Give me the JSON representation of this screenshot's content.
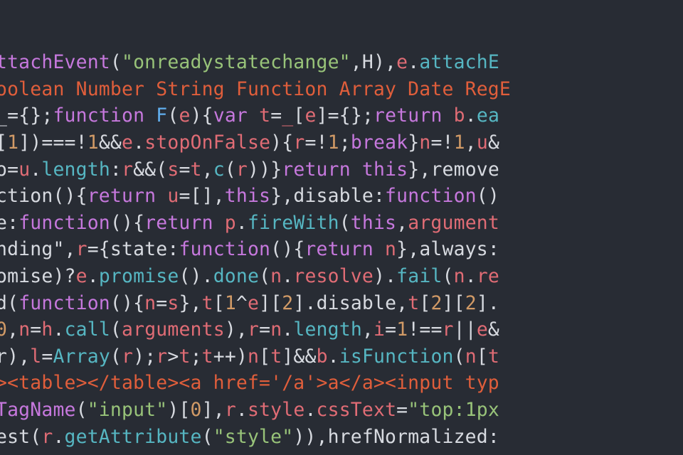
{
  "colors": {
    "background": "#282c34",
    "default": "#d7dae0",
    "keyword": "#c678dd",
    "identifier": "#e06c75",
    "call": "#56b6c2",
    "string": "#98c379",
    "number": "#d19a66",
    "type": "#e05e3b",
    "fn": "#61afef"
  },
  "lines": [
    [
      {
        "c": "c-kw",
        "t": "ttachEvent"
      },
      {
        "c": "c-def",
        "t": "("
      },
      {
        "c": "c-str",
        "t": "\"onreadystatechange\""
      },
      {
        "c": "c-def",
        "t": ",H),"
      },
      {
        "c": "c-red",
        "t": "e"
      },
      {
        "c": "c-def",
        "t": "."
      },
      {
        "c": "c-cyan",
        "t": "attachE"
      }
    ],
    [
      {
        "c": "c-dora",
        "t": "oolean Number String Function Array Date RegE"
      }
    ],
    [
      {
        "c": "c-def",
        "t": "_="
      },
      {
        "c": "c-def",
        "t": "{}"
      },
      {
        "c": "c-def",
        "t": ";"
      },
      {
        "c": "c-kw",
        "t": "function"
      },
      {
        "c": "c-def",
        "t": " "
      },
      {
        "c": "c-fn",
        "t": "F"
      },
      {
        "c": "c-def",
        "t": "("
      },
      {
        "c": "c-red",
        "t": "e"
      },
      {
        "c": "c-def",
        "t": "){"
      },
      {
        "c": "c-kw",
        "t": "var"
      },
      {
        "c": "c-def",
        "t": " "
      },
      {
        "c": "c-red",
        "t": "t"
      },
      {
        "c": "c-def",
        "t": "="
      },
      {
        "c": "c-red",
        "t": "_"
      },
      {
        "c": "c-def",
        "t": "["
      },
      {
        "c": "c-red",
        "t": "e"
      },
      {
        "c": "c-def",
        "t": "]="
      },
      {
        "c": "c-def",
        "t": "{}"
      },
      {
        "c": "c-def",
        "t": ";"
      },
      {
        "c": "c-kw",
        "t": "return"
      },
      {
        "c": "c-def",
        "t": " "
      },
      {
        "c": "c-red",
        "t": "b"
      },
      {
        "c": "c-def",
        "t": "."
      },
      {
        "c": "c-cyan",
        "t": "ea"
      }
    ],
    [
      {
        "c": "c-def",
        "t": "["
      },
      {
        "c": "c-ora",
        "t": "1"
      },
      {
        "c": "c-def",
        "t": "])===!"
      },
      {
        "c": "c-ora",
        "t": "1"
      },
      {
        "c": "c-def",
        "t": "&&"
      },
      {
        "c": "c-red",
        "t": "e"
      },
      {
        "c": "c-def",
        "t": "."
      },
      {
        "c": "c-red",
        "t": "stopOnFalse"
      },
      {
        "c": "c-def",
        "t": "){"
      },
      {
        "c": "c-red",
        "t": "r"
      },
      {
        "c": "c-def",
        "t": "=!"
      },
      {
        "c": "c-ora",
        "t": "1"
      },
      {
        "c": "c-def",
        "t": ";"
      },
      {
        "c": "c-kw",
        "t": "break"
      },
      {
        "c": "c-def",
        "t": "}"
      },
      {
        "c": "c-red",
        "t": "n"
      },
      {
        "c": "c-def",
        "t": "=!"
      },
      {
        "c": "c-ora",
        "t": "1"
      },
      {
        "c": "c-def",
        "t": ","
      },
      {
        "c": "c-red",
        "t": "u"
      },
      {
        "c": "c-def",
        "t": "&"
      }
    ],
    [
      {
        "c": "c-def",
        "t": "o="
      },
      {
        "c": "c-red",
        "t": "u"
      },
      {
        "c": "c-def",
        "t": "."
      },
      {
        "c": "c-cyan",
        "t": "length"
      },
      {
        "c": "c-def",
        "t": ":"
      },
      {
        "c": "c-red",
        "t": "r"
      },
      {
        "c": "c-def",
        "t": "&&("
      },
      {
        "c": "c-red",
        "t": "s"
      },
      {
        "c": "c-def",
        "t": "="
      },
      {
        "c": "c-red",
        "t": "t"
      },
      {
        "c": "c-def",
        "t": ","
      },
      {
        "c": "c-cyan",
        "t": "c"
      },
      {
        "c": "c-def",
        "t": "("
      },
      {
        "c": "c-red",
        "t": "r"
      },
      {
        "c": "c-def",
        "t": "))}"
      },
      {
        "c": "c-kw",
        "t": "return"
      },
      {
        "c": "c-def",
        "t": " "
      },
      {
        "c": "c-kw",
        "t": "this"
      },
      {
        "c": "c-def",
        "t": "},remove"
      }
    ],
    [
      {
        "c": "c-def",
        "t": "ction"
      },
      {
        "c": "c-def",
        "t": "(){"
      },
      {
        "c": "c-kw",
        "t": "return"
      },
      {
        "c": "c-def",
        "t": " "
      },
      {
        "c": "c-red",
        "t": "u"
      },
      {
        "c": "c-def",
        "t": "=[],"
      },
      {
        "c": "c-kw",
        "t": "this"
      },
      {
        "c": "c-def",
        "t": "},disable:"
      },
      {
        "c": "c-kw",
        "t": "function"
      },
      {
        "c": "c-def",
        "t": "()"
      }
    ],
    [
      {
        "c": "c-def",
        "t": "e:"
      },
      {
        "c": "c-kw",
        "t": "function"
      },
      {
        "c": "c-def",
        "t": "(){"
      },
      {
        "c": "c-kw",
        "t": "return"
      },
      {
        "c": "c-def",
        "t": " "
      },
      {
        "c": "c-red",
        "t": "p"
      },
      {
        "c": "c-def",
        "t": "."
      },
      {
        "c": "c-cyan",
        "t": "fireWith"
      },
      {
        "c": "c-def",
        "t": "("
      },
      {
        "c": "c-kw",
        "t": "this"
      },
      {
        "c": "c-def",
        "t": ","
      },
      {
        "c": "c-red",
        "t": "argument"
      }
    ],
    [
      {
        "c": "c-def",
        "t": "nding\""
      },
      {
        "c": "c-def",
        "t": ","
      },
      {
        "c": "c-red",
        "t": "r"
      },
      {
        "c": "c-def",
        "t": "={state:"
      },
      {
        "c": "c-kw",
        "t": "function"
      },
      {
        "c": "c-def",
        "t": "(){"
      },
      {
        "c": "c-kw",
        "t": "return"
      },
      {
        "c": "c-def",
        "t": " "
      },
      {
        "c": "c-red",
        "t": "n"
      },
      {
        "c": "c-def",
        "t": "},always:"
      }
    ],
    [
      {
        "c": "c-def",
        "t": "omise"
      },
      {
        "c": "c-def",
        "t": ")?"
      },
      {
        "c": "c-red",
        "t": "e"
      },
      {
        "c": "c-def",
        "t": "."
      },
      {
        "c": "c-cyan",
        "t": "promise"
      },
      {
        "c": "c-def",
        "t": "()."
      },
      {
        "c": "c-cyan",
        "t": "done"
      },
      {
        "c": "c-def",
        "t": "("
      },
      {
        "c": "c-red",
        "t": "n"
      },
      {
        "c": "c-def",
        "t": "."
      },
      {
        "c": "c-red",
        "t": "resolve"
      },
      {
        "c": "c-def",
        "t": ")."
      },
      {
        "c": "c-cyan",
        "t": "fail"
      },
      {
        "c": "c-def",
        "t": "("
      },
      {
        "c": "c-red",
        "t": "n"
      },
      {
        "c": "c-def",
        "t": "."
      },
      {
        "c": "c-red",
        "t": "re"
      }
    ],
    [
      {
        "c": "c-def",
        "t": "d("
      },
      {
        "c": "c-kw",
        "t": "function"
      },
      {
        "c": "c-def",
        "t": "(){"
      },
      {
        "c": "c-red",
        "t": "n"
      },
      {
        "c": "c-def",
        "t": "="
      },
      {
        "c": "c-red",
        "t": "s"
      },
      {
        "c": "c-def",
        "t": "},"
      },
      {
        "c": "c-red",
        "t": "t"
      },
      {
        "c": "c-def",
        "t": "["
      },
      {
        "c": "c-ora",
        "t": "1"
      },
      {
        "c": "c-def",
        "t": "^"
      },
      {
        "c": "c-red",
        "t": "e"
      },
      {
        "c": "c-def",
        "t": "]["
      },
      {
        "c": "c-ora",
        "t": "2"
      },
      {
        "c": "c-def",
        "t": "].disable,"
      },
      {
        "c": "c-red",
        "t": "t"
      },
      {
        "c": "c-def",
        "t": "["
      },
      {
        "c": "c-ora",
        "t": "2"
      },
      {
        "c": "c-def",
        "t": "]["
      },
      {
        "c": "c-ora",
        "t": "2"
      },
      {
        "c": "c-def",
        "t": "]."
      }
    ],
    [
      {
        "c": "c-ora",
        "t": "0"
      },
      {
        "c": "c-def",
        "t": ","
      },
      {
        "c": "c-red",
        "t": "n"
      },
      {
        "c": "c-def",
        "t": "="
      },
      {
        "c": "c-red",
        "t": "h"
      },
      {
        "c": "c-def",
        "t": "."
      },
      {
        "c": "c-cyan",
        "t": "call"
      },
      {
        "c": "c-def",
        "t": "("
      },
      {
        "c": "c-red",
        "t": "arguments"
      },
      {
        "c": "c-def",
        "t": "),"
      },
      {
        "c": "c-red",
        "t": "r"
      },
      {
        "c": "c-def",
        "t": "="
      },
      {
        "c": "c-red",
        "t": "n"
      },
      {
        "c": "c-def",
        "t": "."
      },
      {
        "c": "c-cyan",
        "t": "length"
      },
      {
        "c": "c-def",
        "t": ","
      },
      {
        "c": "c-red",
        "t": "i"
      },
      {
        "c": "c-def",
        "t": "="
      },
      {
        "c": "c-ora",
        "t": "1"
      },
      {
        "c": "c-def",
        "t": "!=="
      },
      {
        "c": "c-red",
        "t": "r"
      },
      {
        "c": "c-def",
        "t": "||"
      },
      {
        "c": "c-red",
        "t": "e"
      },
      {
        "c": "c-def",
        "t": "&"
      }
    ],
    [
      {
        "c": "c-def",
        "t": "r"
      },
      {
        "c": "c-def",
        "t": "),"
      },
      {
        "c": "c-red",
        "t": "l"
      },
      {
        "c": "c-def",
        "t": "="
      },
      {
        "c": "c-cyan",
        "t": "Array"
      },
      {
        "c": "c-def",
        "t": "("
      },
      {
        "c": "c-red",
        "t": "r"
      },
      {
        "c": "c-def",
        "t": ");"
      },
      {
        "c": "c-red",
        "t": "r"
      },
      {
        "c": "c-def",
        "t": ">"
      },
      {
        "c": "c-red",
        "t": "t"
      },
      {
        "c": "c-def",
        "t": ";"
      },
      {
        "c": "c-red",
        "t": "t"
      },
      {
        "c": "c-def",
        "t": "++)"
      },
      {
        "c": "c-red",
        "t": "n"
      },
      {
        "c": "c-def",
        "t": "["
      },
      {
        "c": "c-red",
        "t": "t"
      },
      {
        "c": "c-def",
        "t": "]&&"
      },
      {
        "c": "c-red",
        "t": "b"
      },
      {
        "c": "c-def",
        "t": "."
      },
      {
        "c": "c-cyan",
        "t": "isFunction"
      },
      {
        "c": "c-def",
        "t": "("
      },
      {
        "c": "c-red",
        "t": "n"
      },
      {
        "c": "c-def",
        "t": "["
      },
      {
        "c": "c-red",
        "t": "t"
      }
    ],
    [
      {
        "c": "c-dora",
        "t": "><table></table><a href='/a'>a</a><input typ"
      }
    ],
    [
      {
        "c": "c-kw",
        "t": "TagName"
      },
      {
        "c": "c-def",
        "t": "("
      },
      {
        "c": "c-str",
        "t": "\"input\""
      },
      {
        "c": "c-def",
        "t": ")["
      },
      {
        "c": "c-ora",
        "t": "0"
      },
      {
        "c": "c-def",
        "t": "],"
      },
      {
        "c": "c-red",
        "t": "r"
      },
      {
        "c": "c-def",
        "t": "."
      },
      {
        "c": "c-red",
        "t": "style"
      },
      {
        "c": "c-def",
        "t": "."
      },
      {
        "c": "c-red",
        "t": "cssText"
      },
      {
        "c": "c-def",
        "t": "="
      },
      {
        "c": "c-str",
        "t": "\"top:1px"
      }
    ],
    [
      {
        "c": "c-def",
        "t": "est"
      },
      {
        "c": "c-def",
        "t": "("
      },
      {
        "c": "c-red",
        "t": "r"
      },
      {
        "c": "c-def",
        "t": "."
      },
      {
        "c": "c-cyan",
        "t": "getAttribute"
      },
      {
        "c": "c-def",
        "t": "("
      },
      {
        "c": "c-str",
        "t": "\"style\""
      },
      {
        "c": "c-def",
        "t": ")),hrefNormalized:"
      }
    ]
  ]
}
